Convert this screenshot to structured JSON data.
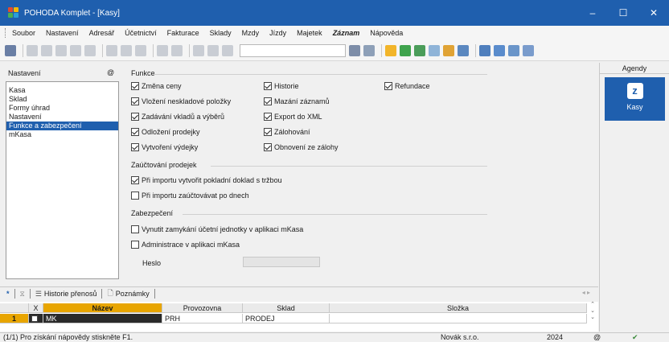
{
  "window": {
    "title": "POHODA Komplet - [Kasy]",
    "controls": [
      "–",
      "☐",
      "✕"
    ]
  },
  "menu": [
    "Soubor",
    "Nastavení",
    "Adresář",
    "Účetnictví",
    "Fakturace",
    "Sklady",
    "Mzdy",
    "Jízdy",
    "Majetek",
    "Záznam",
    "Nápověda"
  ],
  "nav": {
    "title": "Nastavení",
    "pin_icon": "@",
    "items": [
      "Kasa",
      "Sklad",
      "Formy úhrad",
      "Nastavení",
      "Funkce a zabezpečení",
      "mKasa"
    ],
    "selected_index": 4
  },
  "funkce": {
    "title": "Funkce",
    "col1": [
      {
        "label": "Změna ceny",
        "checked": true
      },
      {
        "label": "Vložení neskladové položky",
        "checked": true
      },
      {
        "label": "Zadávání vkladů a výběrů",
        "checked": true
      },
      {
        "label": "Odložení prodejky",
        "checked": true
      },
      {
        "label": "Vytvoření výdejky",
        "checked": true
      }
    ],
    "col2": [
      {
        "label": "Historie",
        "checked": true
      },
      {
        "label": "Mazání záznamů",
        "checked": true
      },
      {
        "label": "Export do XML",
        "checked": true
      },
      {
        "label": "Zálohování",
        "checked": true
      },
      {
        "label": "Obnovení ze zálohy",
        "checked": true
      }
    ],
    "col3": [
      {
        "label": "Refundace",
        "checked": true
      }
    ]
  },
  "zauctovani": {
    "title": "Zaúčtování prodejek",
    "items": [
      {
        "label": "Při importu vytvořit pokladní doklad s tržbou",
        "checked": true
      },
      {
        "label": "Při importu zaúčtovávat po dnech",
        "checked": false
      }
    ]
  },
  "zabezpeceni": {
    "title": "Zabezpečení",
    "items": [
      {
        "label": "Vynutit zamykání účetní jednotky v aplikaci mKasa",
        "checked": false
      },
      {
        "label": "Administrace v aplikaci mKasa",
        "checked": false
      }
    ],
    "password_label": "Heslo",
    "password_value": ""
  },
  "agenda": {
    "title": "Agendy",
    "button_label": "Kasy"
  },
  "tabs": {
    "star": "*",
    "filter_icon": "⧖",
    "items": [
      "Historie přenosů",
      "Poznámky"
    ],
    "nav": "◂ ▸"
  },
  "grid": {
    "headers": [
      "",
      "X",
      "Název",
      "Provozovna",
      "Sklad",
      "Složka"
    ],
    "row": {
      "num": "1",
      "x": "",
      "nazev": "MK",
      "provozovna": "PRH",
      "sklad": "PRODEJ",
      "slozka": ""
    }
  },
  "status": {
    "hint": "(1/1) Pro získání nápovědy stiskněte F1.",
    "company": "Novák s.r.o.",
    "year": "2024",
    "icon": "@"
  }
}
